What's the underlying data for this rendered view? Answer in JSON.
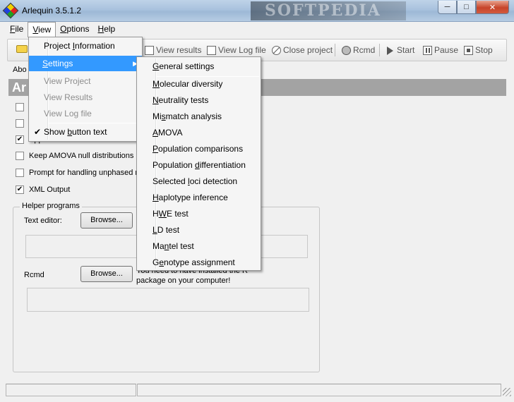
{
  "window": {
    "title": "Arlequin 3.5.1.2",
    "watermark": "SOFTPEDIA",
    "minimize": "─",
    "maximize": "□",
    "close": "✕"
  },
  "menubar": [
    {
      "label": "File",
      "mnemonic": "F",
      "rest": "ile"
    },
    {
      "label": "View",
      "mnemonic": "V",
      "rest": "iew"
    },
    {
      "label": "Options",
      "mnemonic": "O",
      "rest": "ptions"
    },
    {
      "label": "Help",
      "mnemonic": "H",
      "rest": "elp"
    }
  ],
  "toolbar": {
    "view_results": "View results",
    "view_log_file": "View Log file",
    "close_project": "Close project",
    "rcmd": "Rcmd",
    "start": "Start",
    "pause": "Pause",
    "stop": "Stop"
  },
  "tab_label": "Abo",
  "header_text": "Ar",
  "checks": [
    {
      "label": "",
      "checked": false
    },
    {
      "label": "",
      "checked": false
    },
    {
      "label": "Append results",
      "checked": true
    },
    {
      "label": "Keep AMOVA null distributions",
      "checked": false
    },
    {
      "label": "Prompt for handling unphased m",
      "checked": false
    },
    {
      "label": "XML Output",
      "checked": true
    }
  ],
  "helper": {
    "title": "Helper programs",
    "text_editor_label": "Text editor:",
    "browse": "Browse...",
    "rcmd_label": "Rcmd",
    "r_note": "You need to have installed the R package on your computer!"
  },
  "view_menu": {
    "items": [
      {
        "pre": "Project ",
        "mn": "I",
        "post": "nformation",
        "state": "normal"
      },
      {
        "pre": "",
        "mn": "S",
        "post": "ettings",
        "state": "highlight",
        "submenu": true
      },
      {
        "pre": "View ",
        "mn": "P",
        "post": "roject",
        "state": "disabled"
      },
      {
        "pre": "View ",
        "mn": "R",
        "post": "esults",
        "state": "disabled"
      },
      {
        "pre": "View ",
        "mn": "L",
        "post": "og file",
        "state": "disabled"
      },
      {
        "pre": "Show ",
        "mn": "b",
        "post": "utton text",
        "state": "checked"
      }
    ],
    "check_glyph": "✔",
    "arrow_glyph": "▶"
  },
  "settings_menu": {
    "items": [
      {
        "pre": "",
        "mn": "G",
        "post": "eneral settings"
      },
      {
        "pre": "",
        "mn": "M",
        "post": "olecular diversity"
      },
      {
        "pre": "",
        "mn": "N",
        "post": "eutrality tests"
      },
      {
        "pre": "Mi",
        "mn": "s",
        "post": "match analysis"
      },
      {
        "pre": "",
        "mn": "A",
        "post": "MOVA"
      },
      {
        "pre": "",
        "mn": "P",
        "post": "opulation comparisons"
      },
      {
        "pre": "Population ",
        "mn": "d",
        "post": "ifferentiation"
      },
      {
        "pre": "Selected ",
        "mn": "l",
        "post": "oci detection"
      },
      {
        "pre": "",
        "mn": "H",
        "post": "aplotype inference"
      },
      {
        "pre": "H",
        "mn": "W",
        "post": "E test"
      },
      {
        "pre": "",
        "mn": "L",
        "post": "D test"
      },
      {
        "pre": "Ma",
        "mn": "n",
        "post": "tel test"
      },
      {
        "pre": "G",
        "mn": "e",
        "post": "notype assignment"
      }
    ]
  }
}
